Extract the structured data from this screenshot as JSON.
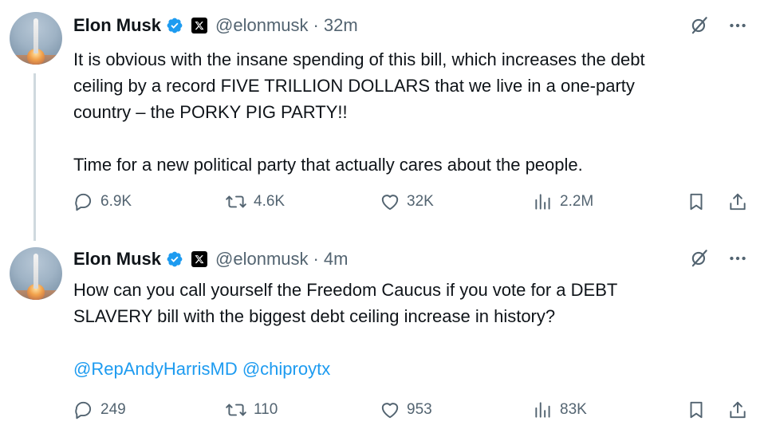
{
  "tweets": [
    {
      "author_name": "Elon Musk",
      "handle": "@elonmusk",
      "separator": "·",
      "time": "32m",
      "text": "It is obvious with the insane spending of this bill, which increases the debt\nceiling by a record FIVE TRILLION DOLLARS that we live in a one-party\ncountry – the PORKY PIG PARTY!!\n\nTime for a new political party that actually cares about the people.",
      "mentions": [],
      "replies": "6.9K",
      "reposts": "4.6K",
      "likes": "32K",
      "views": "2.2M"
    },
    {
      "author_name": "Elon Musk",
      "handle": "@elonmusk",
      "separator": "·",
      "time": "4m",
      "text": "How can you call yourself the Freedom Caucus if you vote for a DEBT\nSLAVERY bill with the biggest debt ceiling increase in history?",
      "mentions": [
        "@RepAndyHarrisMD",
        "@chiproytx"
      ],
      "replies": "249",
      "reposts": "110",
      "likes": "953",
      "views": "83K"
    }
  ],
  "icons": {
    "verified": "verified-badge-icon",
    "affiliation": "x-logo-icon",
    "grok": "grok-icon",
    "more": "more-icon",
    "reply": "reply-icon",
    "repost": "repost-icon",
    "like": "heart-icon",
    "views": "views-icon",
    "bookmark": "bookmark-icon",
    "share": "share-icon"
  },
  "colors": {
    "text": "#0f1419",
    "secondary": "#536471",
    "link": "#1d9bf0",
    "verified": "#1d9bf0"
  }
}
